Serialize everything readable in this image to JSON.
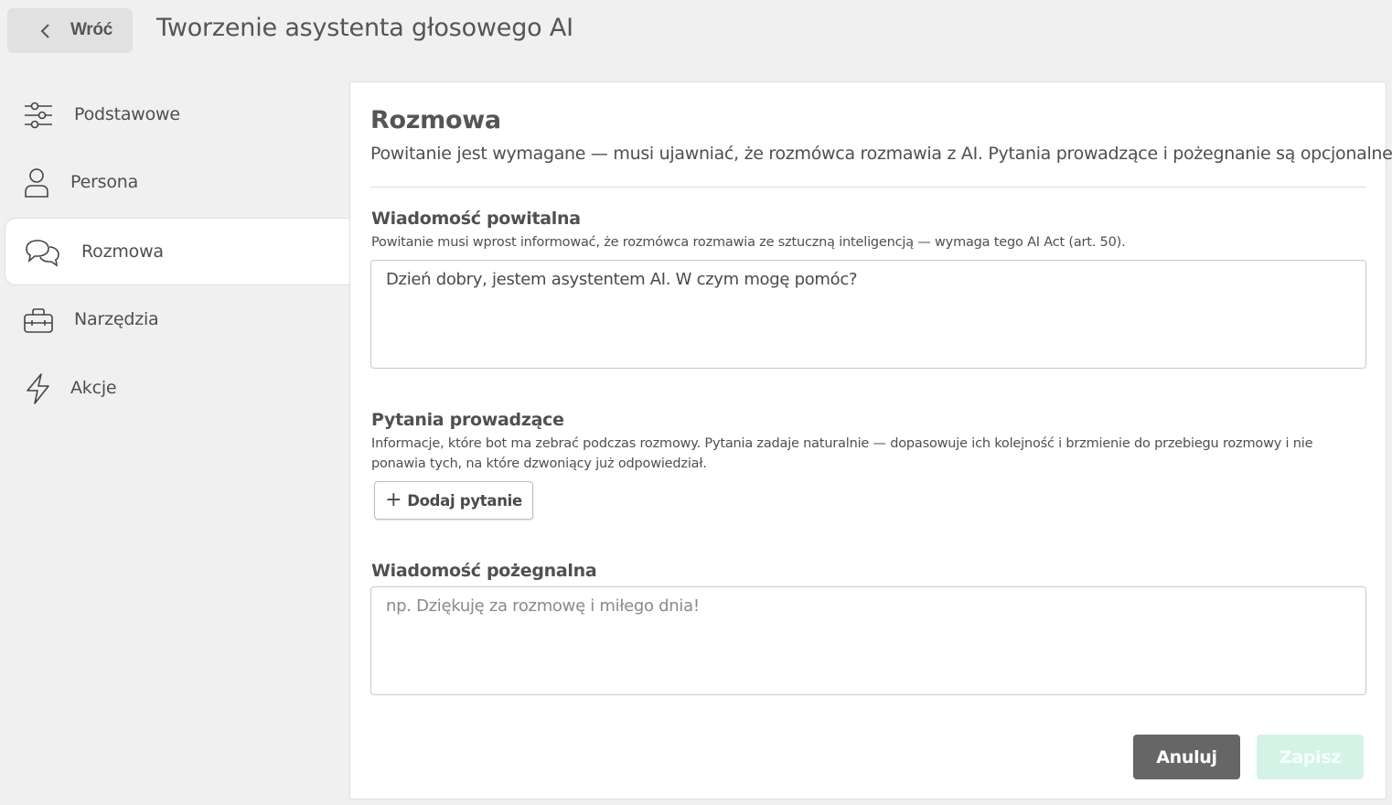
{
  "header": {
    "back_label": "Wróć",
    "title": "Tworzenie asystenta głosowego AI"
  },
  "sidebar": {
    "items": [
      {
        "label": "Podstawowe",
        "icon": "sliders-icon",
        "active": false
      },
      {
        "label": "Persona",
        "icon": "user-icon",
        "active": false
      },
      {
        "label": "Rozmowa",
        "icon": "chat-bubbles-icon",
        "active": true
      },
      {
        "label": "Narzędzia",
        "icon": "toolbox-icon",
        "active": false
      },
      {
        "label": "Akcje",
        "icon": "lightning-icon",
        "active": false
      }
    ]
  },
  "section": {
    "title": "Rozmowa",
    "description": "Powitanie jest wymagane — musi ujawniać, że rozmówca rozmawia z AI. Pytania prowadzące i pożegnanie są opcjonalne."
  },
  "welcome": {
    "label": "Wiadomość powitalna",
    "hint": "Powitanie musi wprost informować, że rozmówca rozmawia ze sztuczną inteligencją — wymaga tego AI Act (art. 50).",
    "value": "Dzień dobry, jestem asystentem AI. W czym mogę pomóc?"
  },
  "questions": {
    "label": "Pytania prowadzące",
    "hint_line1": "Informacje, które bot ma zebrać podczas rozmowy. Pytania zadaje naturalnie — dopasowuje ich kolejność i brzmienie do przebiegu rozmowy i nie",
    "hint_line2": "ponawia tych, na które dzwoniący już odpowiedział.",
    "add_label": "Dodaj pytanie"
  },
  "farewell": {
    "label": "Wiadomość pożegnalna",
    "placeholder": "np. Dziękuję za rozmowę i miłego dnia!",
    "value": ""
  },
  "actions": {
    "cancel_label": "Anuluj",
    "save_label": "Zapisz"
  },
  "colors": {
    "background": "#f0f0f0",
    "panel": "#ffffff",
    "cancel_bg": "#666666",
    "save_bg_disabled": "#d4f3e6"
  }
}
